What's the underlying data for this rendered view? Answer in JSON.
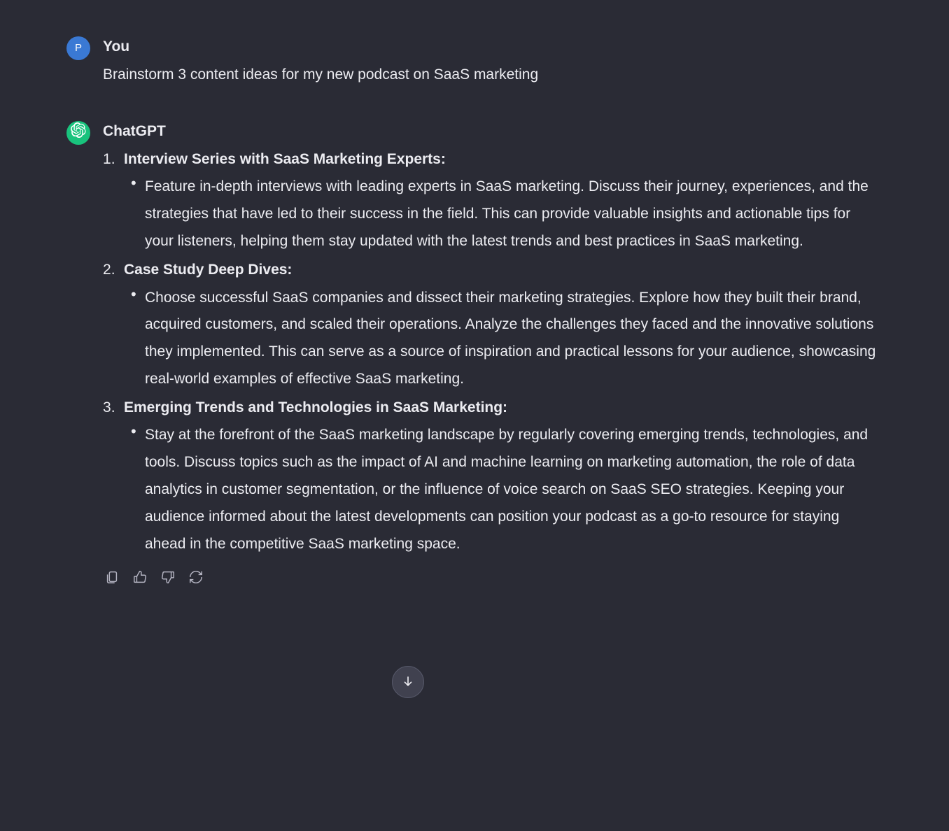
{
  "user": {
    "avatar_letter": "P",
    "author": "You",
    "text": "Brainstorm 3 content ideas for my new podcast on SaaS marketing"
  },
  "assistant": {
    "author": "ChatGPT",
    "ideas": [
      {
        "title": "Interview Series with SaaS Marketing Experts:",
        "body": "Feature in-depth interviews with leading experts in SaaS marketing. Discuss their journey, experiences, and the strategies that have led to their success in the field. This can provide valuable insights and actionable tips for your listeners, helping them stay updated with the latest trends and best practices in SaaS marketing."
      },
      {
        "title": "Case Study Deep Dives:",
        "body": "Choose successful SaaS companies and dissect their marketing strategies. Explore how they built their brand, acquired customers, and scaled their operations. Analyze the challenges they faced and the innovative solutions they implemented. This can serve as a source of inspiration and practical lessons for your audience, showcasing real-world examples of effective SaaS marketing."
      },
      {
        "title": "Emerging Trends and Technologies in SaaS Marketing:",
        "body": "Stay at the forefront of the SaaS marketing landscape by regularly covering emerging trends, technologies, and tools. Discuss topics such as the impact of AI and machine learning on marketing automation, the role of data analytics in customer segmentation, or the influence of voice search on SaaS SEO strategies. Keeping your audience informed about the latest developments can position your podcast as a go-to resource for staying ahead in the competitive SaaS marketing space."
      }
    ]
  },
  "actions": {
    "copy": "Copy",
    "thumbs_up": "Good response",
    "thumbs_down": "Bad response",
    "regenerate": "Regenerate"
  },
  "scroll_button": "Scroll to bottom"
}
